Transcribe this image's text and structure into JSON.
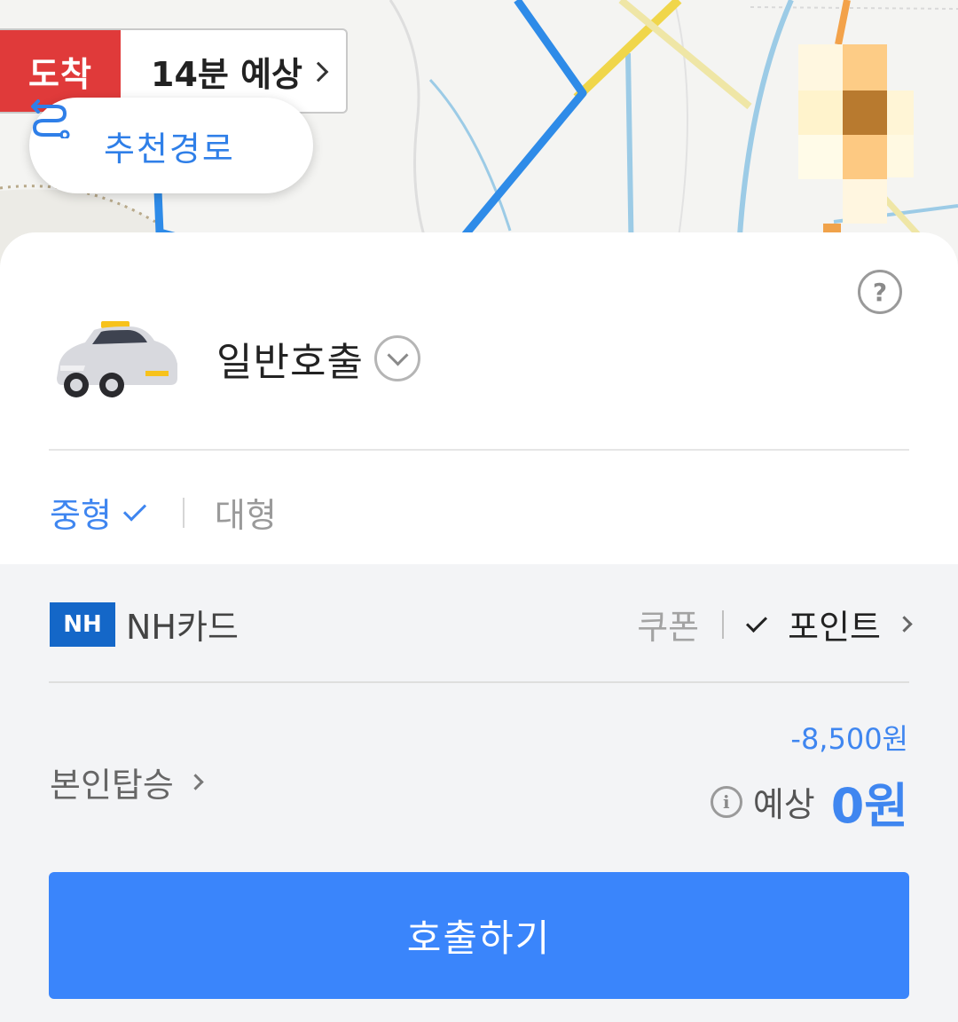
{
  "map": {
    "eta": {
      "arrive_label": "도착",
      "time_label": "14분 예상"
    },
    "recommend_route_label": "추천경로"
  },
  "sheet": {
    "call_type": "일반호출",
    "car_sizes": {
      "selected": "중형",
      "other": "대형"
    },
    "payment": {
      "card_logo": "NH",
      "card_name": "NH카드",
      "coupon_label": "쿠폰",
      "point_label": "포인트"
    },
    "self_ride_label": "본인탑승",
    "discount_amount": "-8,500원",
    "estimate_label": "예상",
    "estimate_price": "0원",
    "call_button_label": "호출하기"
  },
  "colors": {
    "accent": "#3a85fb",
    "arrive_badge": "#e03a3a",
    "nh_brand": "#1467c8",
    "route_line": "#2e8be8"
  }
}
